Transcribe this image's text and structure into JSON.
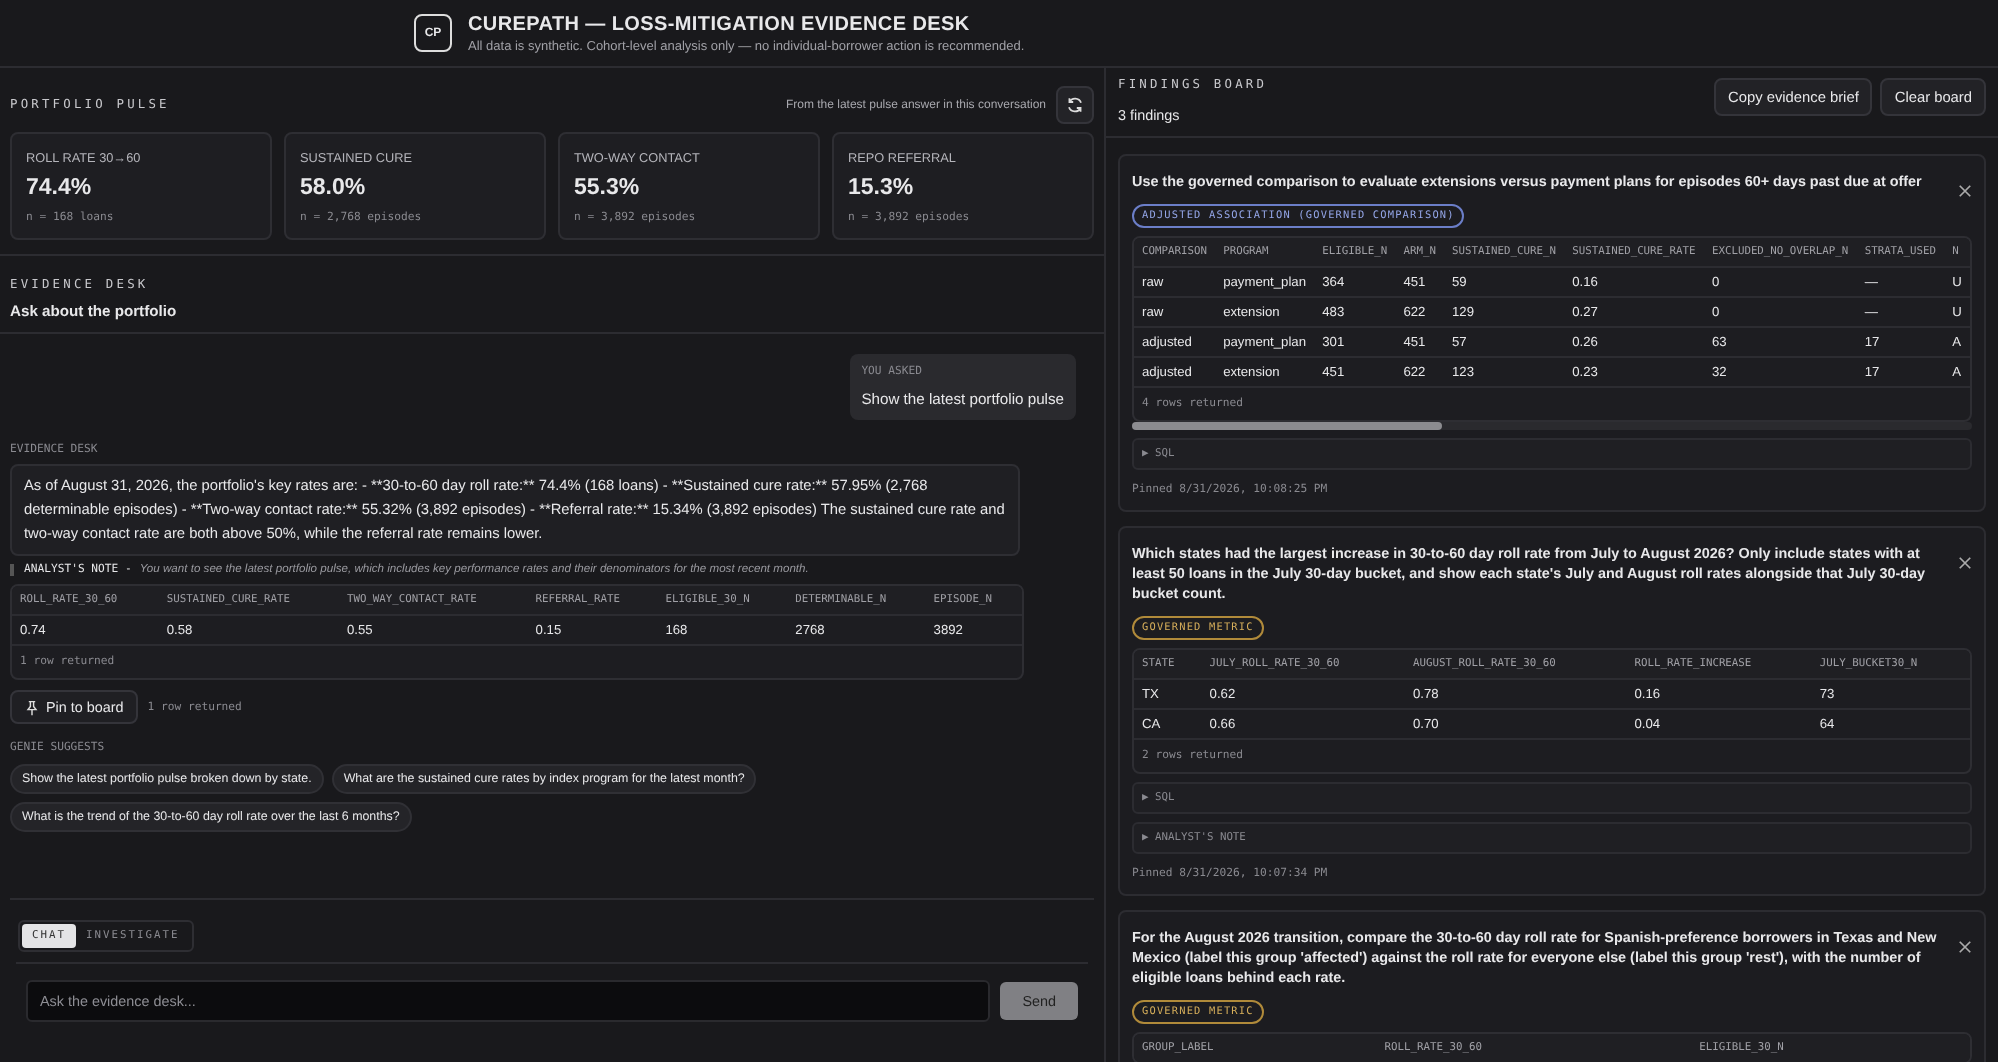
{
  "header": {
    "logo": "CP",
    "title": "CUREPATH — LOSS-MITIGATION EVIDENCE DESK",
    "subtitle": "All data is synthetic. Cohort-level analysis only — no individual-borrower action is recommended."
  },
  "pulse": {
    "label": "PORTFOLIO PULSE",
    "note": "From the latest pulse answer in this conversation",
    "metrics": [
      {
        "label": "ROLL RATE 30→60",
        "value": "74.4%",
        "n": "n = 168 loans"
      },
      {
        "label": "SUSTAINED CURE",
        "value": "58.0%",
        "n": "n = 2,768 episodes"
      },
      {
        "label": "TWO-WAY CONTACT",
        "value": "55.3%",
        "n": "n = 3,892 episodes"
      },
      {
        "label": "REPO REFERRAL",
        "value": "15.3%",
        "n": "n = 3,892 episodes"
      }
    ]
  },
  "desk": {
    "label": "EVIDENCE DESK",
    "title": "Ask about the portfolio"
  },
  "conversation": {
    "question_label": "YOU ASKED",
    "question": "Show the latest portfolio pulse",
    "answer_label": "EVIDENCE DESK",
    "answer": "As of August 31, 2026, the portfolio's key rates are: - **30-to-60 day roll rate:** 74.4% (168 loans) - **Sustained cure rate:** 57.95% (2,768 determinable episodes) - **Two-way contact rate:** 55.32% (3,892 episodes) - **Referral rate:** 15.34% (3,892 episodes) The sustained cure rate and two-way contact rate are both above 50%, while the referral rate remains lower.",
    "note_label": "ANALYST'S NOTE -",
    "note": "You want to see the latest portfolio pulse, which includes key performance rates and their denominators for the most recent month.",
    "table": {
      "columns": [
        "ROLL_RATE_30_60",
        "SUSTAINED_CURE_RATE",
        "TWO_WAY_CONTACT_RATE",
        "REFERRAL_RATE",
        "ELIGIBLE_30_N",
        "DETERMINABLE_N",
        "EPISODE_N"
      ],
      "rows": [
        [
          "0.74",
          "0.58",
          "0.55",
          "0.15",
          "168",
          "2768",
          "3892"
        ]
      ],
      "footer": "1 row returned"
    },
    "pin_button": "Pin to board",
    "pin_note": "1 row returned"
  },
  "suggestions": {
    "label": "GENIE SUGGESTS",
    "chips": [
      "Show the latest portfolio pulse broken down by state.",
      "What are the sustained cure rates by index program for the latest month?",
      "What is the trend of the 30-to-60 day roll rate over the last 6 months?"
    ]
  },
  "composer": {
    "tabs": [
      {
        "label": "CHAT",
        "selected": true
      },
      {
        "label": "INVESTIGATE",
        "selected": false
      }
    ],
    "placeholder": "Ask the evidence desk...",
    "send_button": "Send"
  },
  "board": {
    "label": "FINDINGS BOARD",
    "count": "3 findings",
    "buttons": [
      "Copy evidence brief",
      "Clear board"
    ],
    "cards": [
      {
        "question": "Use the governed comparison to evaluate extensions versus payment plans for episodes 60+ days past due at offer",
        "badge": {
          "text": "ADJUSTED ASSOCIATION (GOVERNED COMPARISON)",
          "kind": "adjusted"
        },
        "table": {
          "columns": [
            "COMPARISON",
            "PROGRAM",
            "ELIGIBLE_N",
            "ARM_N",
            "SUSTAINED_CURE_N",
            "SUSTAINED_CURE_RATE",
            "EXCLUDED_NO_OVERLAP_N",
            "STRATA_USED",
            "N"
          ],
          "rows": [
            [
              "raw",
              "payment_plan",
              "364",
              "451",
              "59",
              "0.16",
              "0",
              "—",
              "U"
            ],
            [
              "raw",
              "extension",
              "483",
              "622",
              "129",
              "0.27",
              "0",
              "—",
              "U"
            ],
            [
              "adjusted",
              "payment_plan",
              "301",
              "451",
              "57",
              "0.26",
              "63",
              "17",
              "A"
            ],
            [
              "adjusted",
              "extension",
              "451",
              "622",
              "123",
              "0.23",
              "32",
              "17",
              "A"
            ]
          ],
          "footer": "4 rows returned",
          "scrollbar": true
        },
        "sections": [
          "▶ SQL"
        ],
        "pinned": "Pinned 8/31/2026, 10:08:25 PM"
      },
      {
        "question": "Which states had the largest increase in 30-to-60 day roll rate from July to August 2026? Only include states with at least 50 loans in the July 30-day bucket, and show each state's July and August roll rates alongside that July 30-day bucket count.",
        "badge": {
          "text": "GOVERNED METRIC",
          "kind": "governed"
        },
        "table": {
          "columns": [
            "STATE",
            "JULY_ROLL_RATE_30_60",
            "AUGUST_ROLL_RATE_30_60",
            "ROLL_RATE_INCREASE",
            "JULY_BUCKET30_N"
          ],
          "rows": [
            [
              "TX",
              "0.62",
              "0.78",
              "0.16",
              "73"
            ],
            [
              "CA",
              "0.66",
              "0.70",
              "0.04",
              "64"
            ]
          ],
          "footer": "2 rows returned"
        },
        "sections": [
          "▶ SQL",
          "▶ ANALYST'S NOTE"
        ],
        "pinned": "Pinned 8/31/2026, 10:07:34 PM"
      },
      {
        "question": "For the August 2026 transition, compare the 30-to-60 day roll rate for Spanish-preference borrowers in Texas and New Mexico (label this group 'affected') against the roll rate for everyone else (label this group 'rest'), with the number of eligible loans behind each rate.",
        "badge": {
          "text": "GOVERNED METRIC",
          "kind": "governed"
        },
        "table": {
          "columns": [
            "GROUP_LABEL",
            "ROLL_RATE_30_60",
            "ELIGIBLE_30_N"
          ]
        }
      }
    ]
  }
}
